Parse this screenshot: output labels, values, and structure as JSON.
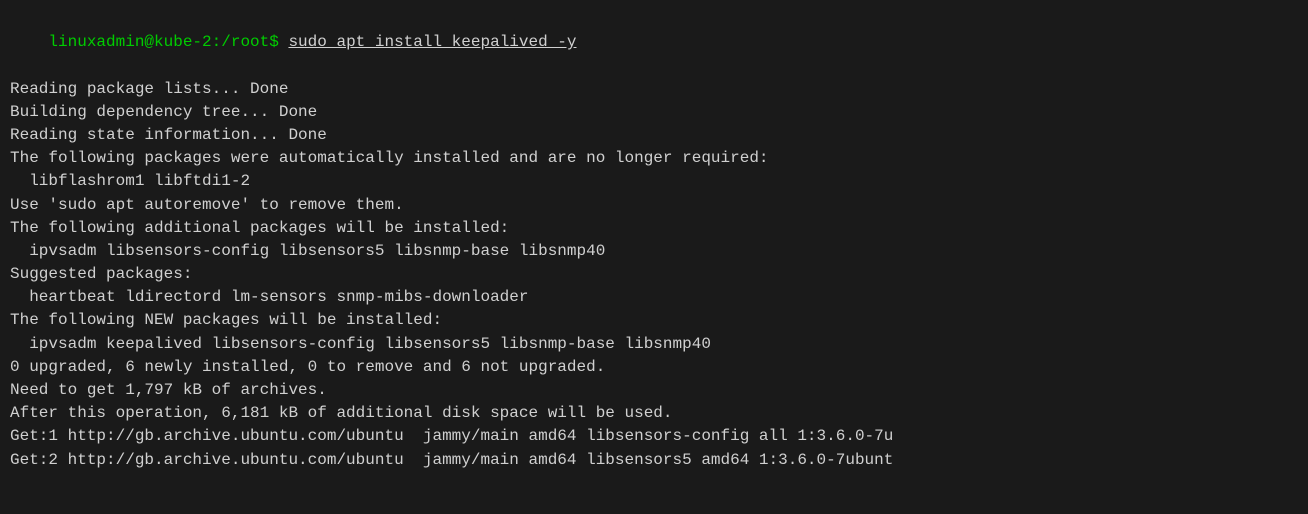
{
  "terminal": {
    "prompt": "linuxadmin@kube-2:/root$ ",
    "command": "sudo apt install keepalived -y",
    "lines": [
      {
        "text": "Reading package lists... Done",
        "color": "white"
      },
      {
        "text": "Building dependency tree... Done",
        "color": "white"
      },
      {
        "text": "Reading state information... Done",
        "color": "white"
      },
      {
        "text": "The following packages were automatically installed and are no longer required:",
        "color": "white"
      },
      {
        "text": "  libflashrom1 libftdi1-2",
        "color": "white"
      },
      {
        "text": "Use 'sudo apt autoremove' to remove them.",
        "color": "white"
      },
      {
        "text": "The following additional packages will be installed:",
        "color": "white"
      },
      {
        "text": "  ipvsadm libsensors-config libsensors5 libsnmp-base libsnmp40",
        "color": "white"
      },
      {
        "text": "Suggested packages:",
        "color": "white"
      },
      {
        "text": "  heartbeat ldirectord lm-sensors snmp-mibs-downloader",
        "color": "white"
      },
      {
        "text": "The following NEW packages will be installed:",
        "color": "white"
      },
      {
        "text": "  ipvsadm keepalived libsensors-config libsensors5 libsnmp-base libsnmp40",
        "color": "white"
      },
      {
        "text": "0 upgraded, 6 newly installed, 0 to remove and 6 not upgraded.",
        "color": "white"
      },
      {
        "text": "Need to get 1,797 kB of archives.",
        "color": "white"
      },
      {
        "text": "After this operation, 6,181 kB of additional disk space will be used.",
        "color": "white"
      },
      {
        "text": "Get:1 http://gb.archive.ubuntu.com/ubuntu  jammy/main amd64 libsensors-config all 1:3.6.0-7u",
        "color": "white"
      },
      {
        "text": "Get:2 http://gb.archive.ubuntu.com/ubuntu  jammy/main amd64 libsensors5 amd64 1:3.6.0-7ubunt",
        "color": "white"
      }
    ]
  }
}
